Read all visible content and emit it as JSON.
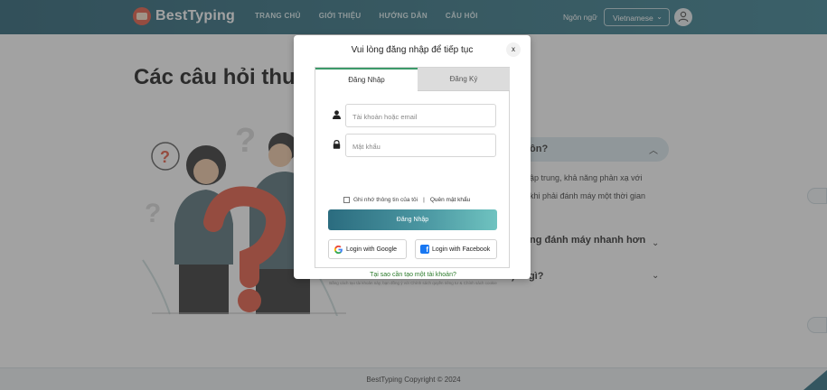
{
  "header": {
    "logo_text": "BestTyping",
    "nav": [
      "TRANG CHỦ",
      "GIỚI THIỆU",
      "HƯỚNG DẪN",
      "CÂU HỎI"
    ],
    "language_label": "Ngôn ngữ",
    "language_selected": "Vietnamese"
  },
  "main": {
    "title": "Các câu hỏi thu",
    "faq_active_question": "ôn?",
    "faq_answer_lines": [
      "ập trung, khả năng phản xạ với",
      "khi phải đánh máy một thời gian"
    ],
    "faq_items": [
      "ng đánh máy nhanh hơn",
      ") là gì?"
    ]
  },
  "footer": {
    "copyright": "BestTyping Copyright © 2024"
  },
  "modal": {
    "title": "Vui lòng đăng nhập để tiếp tục",
    "close_label": "x",
    "tabs": {
      "login": "Đăng Nhập",
      "register": "Đăng Ký"
    },
    "username_placeholder": "Tài khoản hoặc email",
    "password_placeholder": "Mật khẩu",
    "remember_label": "Ghi nhớ thông tin của tôi",
    "separator": "|",
    "forgot_label": "Quên mật khẩu",
    "login_button": "Đăng Nhập",
    "google_button": "Login with Google",
    "facebook_button": "Login with Facebook",
    "why_link": "Tại sao cần tạo một tài khoản?",
    "terms_text": "Bằng cách tạo tài khoản này, bạn đồng ý với Chính sách quyền riêng tư & Chính sách cookie"
  },
  "colors": {
    "header": "#2b6f80",
    "accent_green": "#3c9a6a",
    "login_button": "#4d9aa4",
    "illustration_red": "#e4533a"
  },
  "icons": [
    "user-icon",
    "lock-icon",
    "google-icon",
    "facebook-icon",
    "chevron-down-icon",
    "chevron-up-icon",
    "close-icon"
  ]
}
